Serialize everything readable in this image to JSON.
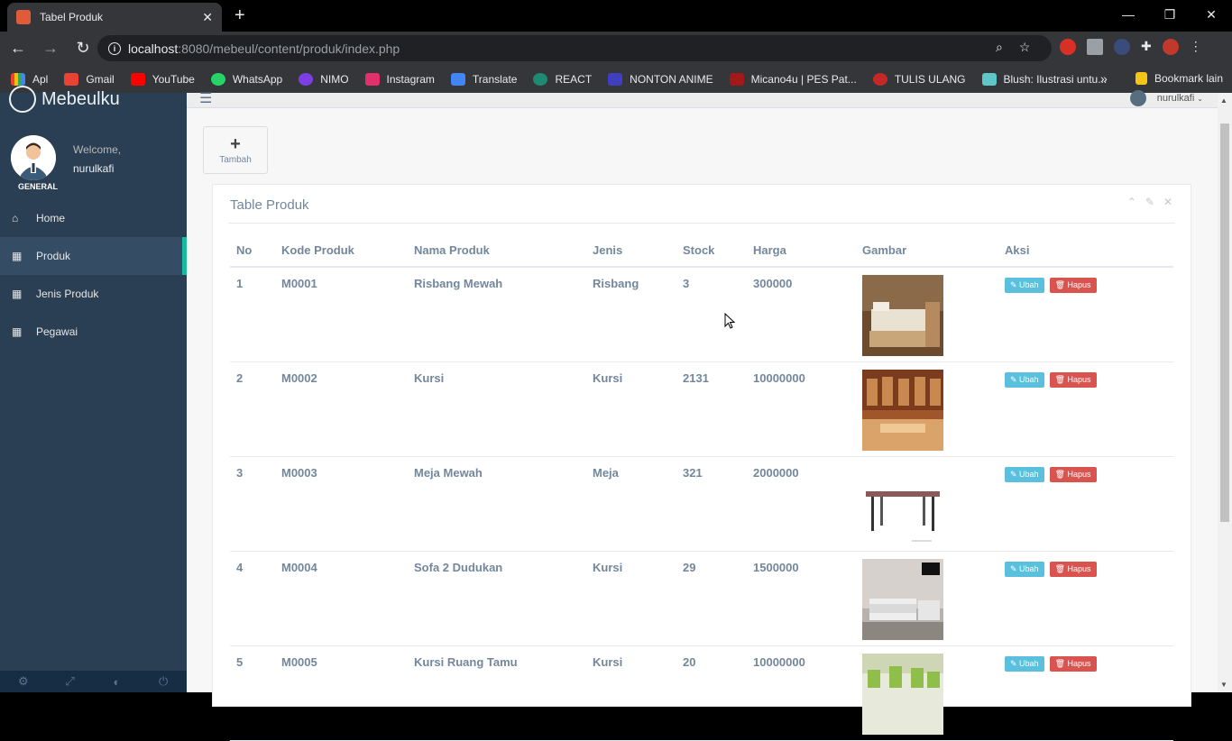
{
  "browser": {
    "tab_title": "Tabel Produk",
    "url_host": "localhost",
    "url_rest": ":8080/mebeul/content/produk/index.php",
    "bookmarks": [
      "Apl",
      "Gmail",
      "YouTube",
      "WhatsApp",
      "NIMO",
      "Instagram",
      "Translate",
      "REACT",
      "NONTON ANIME",
      "Micano4u | PES Pat...",
      "TULIS ULANG",
      "Blush: Ilustrasi untu..."
    ],
    "bookmark_other": "Bookmark lain"
  },
  "sidebar": {
    "brand": "Mebeulku",
    "welcome": "Welcome,",
    "username": "nurulkafi",
    "role": "GENERAL",
    "items": [
      {
        "label": "Home"
      },
      {
        "label": "Produk"
      },
      {
        "label": "Jenis Produk"
      },
      {
        "label": "Pegawai"
      }
    ]
  },
  "topnav": {
    "user": "nurulkafi"
  },
  "main": {
    "add_label": "Tambah",
    "panel_title": "Table Produk",
    "columns": [
      "No",
      "Kode Produk",
      "Nama Produk",
      "Jenis",
      "Stock",
      "Harga",
      "Gambar",
      "Aksi"
    ],
    "edit_label": "Ubah",
    "delete_label": "Hapus",
    "rows": [
      {
        "no": "1",
        "kode": "M0001",
        "nama": "Risbang Mewah",
        "jenis": "Risbang",
        "stock": "3",
        "harga": "300000",
        "img": "bed"
      },
      {
        "no": "2",
        "kode": "M0002",
        "nama": "Kursi",
        "jenis": "Kursi",
        "stock": "2131",
        "harga": "10000000",
        "img": "chairs"
      },
      {
        "no": "3",
        "kode": "M0003",
        "nama": "Meja Mewah",
        "jenis": "Meja",
        "stock": "321",
        "harga": "2000000",
        "img": "table"
      },
      {
        "no": "4",
        "kode": "M0004",
        "nama": "Sofa 2 Dudukan",
        "jenis": "Kursi",
        "stock": "29",
        "harga": "1500000",
        "img": "sofa"
      },
      {
        "no": "5",
        "kode": "M0005",
        "nama": "Kursi Ruang Tamu",
        "jenis": "Kursi",
        "stock": "20",
        "harga": "10000000",
        "img": "living"
      }
    ]
  }
}
